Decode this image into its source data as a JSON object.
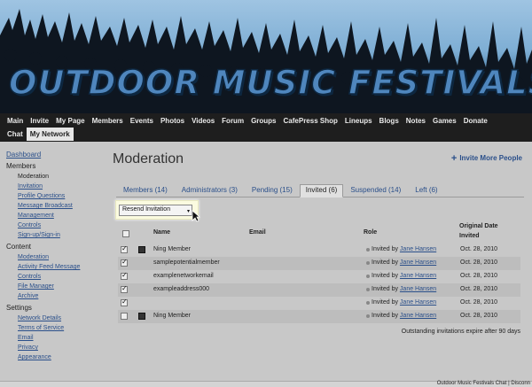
{
  "site": {
    "title": "OUTDOOR MUSIC FESTIVALS"
  },
  "nav": {
    "row1": [
      "Main",
      "Invite",
      "My Page",
      "Members",
      "Events",
      "Photos",
      "Videos",
      "Forum",
      "Groups",
      "CafePress Shop",
      "Lineups",
      "Blogs",
      "Notes",
      "Games",
      "Donate"
    ],
    "row2": [
      "Chat",
      "My Network"
    ],
    "active": "My Network"
  },
  "sidebar": {
    "dashboard": "Dashboard",
    "sections": [
      {
        "heading": "Members",
        "items": [
          "Moderation",
          "Invitation",
          "Profile Questions",
          "Message Broadcast",
          "Management",
          "Controls",
          "Sign-up/Sign-in"
        ],
        "current": "Moderation"
      },
      {
        "heading": "Content",
        "items": [
          "Moderation",
          "Activity Feed Message",
          "Controls",
          "File Manager",
          "Archive"
        ]
      },
      {
        "heading": "Settings",
        "items": [
          "Network Details",
          "Terms of Service",
          "Email",
          "Privacy",
          "Appearance"
        ]
      }
    ]
  },
  "main": {
    "title": "Moderation",
    "invite_more": "Invite More People",
    "tabs": [
      {
        "label": "Members (14)",
        "active": false
      },
      {
        "label": "Administrators (3)",
        "active": false
      },
      {
        "label": "Pending (15)",
        "active": false
      },
      {
        "label": "Invited (6)",
        "active": true
      },
      {
        "label": "Suspended (14)",
        "active": false
      },
      {
        "label": "Left (6)",
        "active": false
      }
    ],
    "action_select": "Resend Invitation",
    "columns": {
      "name": "Name",
      "email": "Email",
      "role": "Role",
      "date_line1": "Original Date",
      "date_line2": "Invited"
    },
    "rows": [
      {
        "checked": true,
        "avatar": true,
        "name": "Ning Member",
        "role_prefix": "Invited by",
        "inviter": "Jane Hansen",
        "date": "Oct. 28, 2010"
      },
      {
        "checked": true,
        "avatar": false,
        "name": "samplepotentialmember",
        "role_prefix": "Invited by",
        "inviter": "Jane Hansen",
        "date": "Oct. 28, 2010"
      },
      {
        "checked": true,
        "avatar": false,
        "name": "examplenetworkemail",
        "role_prefix": "Invited by",
        "inviter": "Jane Hansen",
        "date": "Oct. 28, 2010"
      },
      {
        "checked": true,
        "avatar": false,
        "name": "exampleaddress000",
        "role_prefix": "Invited by",
        "inviter": "Jane Hansen",
        "date": "Oct. 28, 2010"
      },
      {
        "checked": true,
        "avatar": false,
        "name": "",
        "role_prefix": "Invited by",
        "inviter": "Jane Hansen",
        "date": "Oct. 28, 2010"
      },
      {
        "checked": false,
        "avatar": true,
        "name": "Ning Member",
        "role_prefix": "Invited by",
        "inviter": "Jane Hansen",
        "date": "Oct. 28, 2010"
      }
    ],
    "footnote": "Outstanding invitations expire after 90 days"
  },
  "chatbar": {
    "text": "Outdoor Music Festivals Chat | Disconn"
  }
}
